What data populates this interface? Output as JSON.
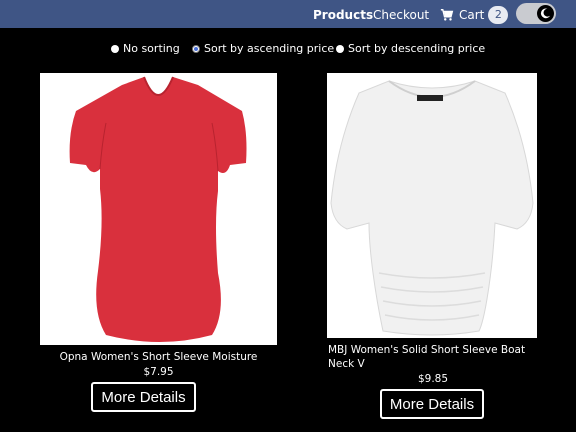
{
  "nav": {
    "products_label": "Products",
    "checkout_label": "Checkout",
    "cart_label": "Cart",
    "cart_count": "2",
    "theme_icon": "moon-icon"
  },
  "sorting": {
    "options": [
      {
        "label": "No sorting",
        "checked": false
      },
      {
        "label": "Sort by ascending price",
        "checked": true
      },
      {
        "label": "Sort by descending price",
        "checked": false
      }
    ]
  },
  "products": [
    {
      "name": "Opna Women's Short Sleeve Moisture",
      "price": "$7.95",
      "button_label": "More Details",
      "image_color": "#d9303d"
    },
    {
      "name": "MBJ Women's Solid Short Sleeve Boat Neck V",
      "price": "$9.85",
      "button_label": "More Details",
      "image_color": "#f6f6f6"
    }
  ],
  "colors": {
    "navbar": "#3f5585",
    "background": "#000000"
  }
}
